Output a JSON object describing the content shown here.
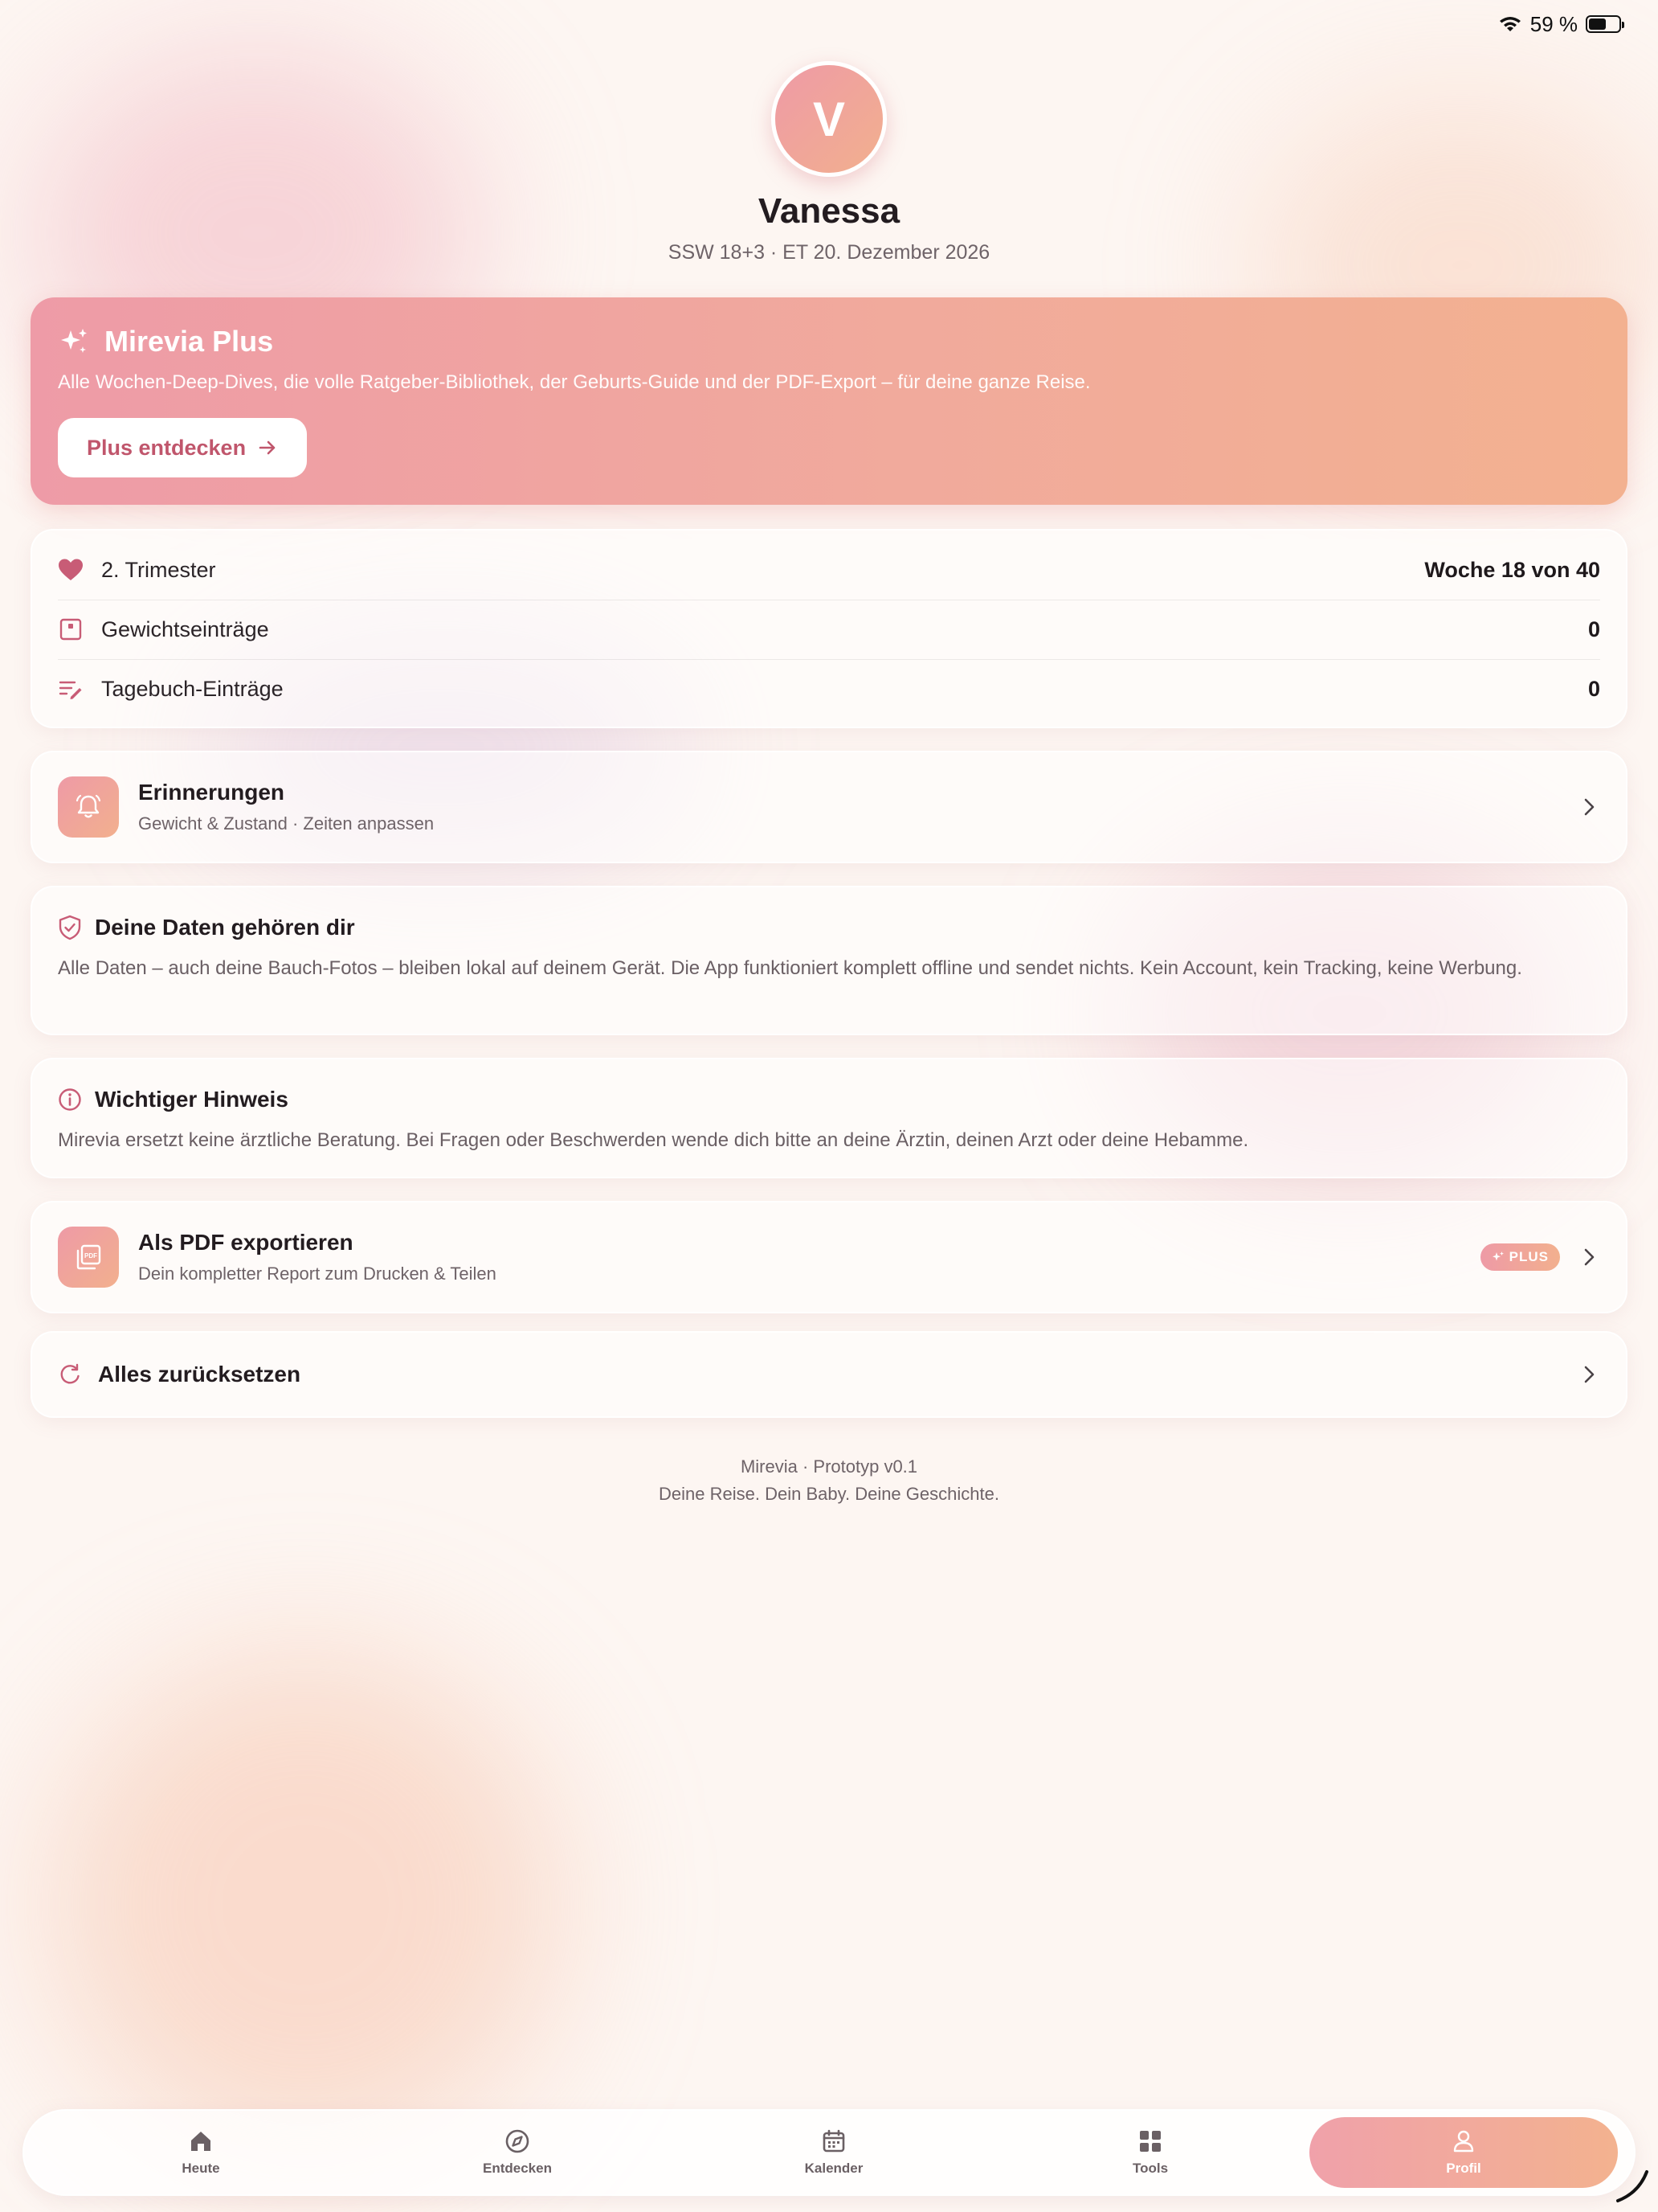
{
  "status": {
    "battery": "59 %"
  },
  "profile": {
    "initial": "V",
    "name": "Vanessa",
    "subtitle": "SSW 18+3 · ET 20. Dezember 2026"
  },
  "plus": {
    "title": "Mirevia Plus",
    "description": "Alle Wochen-Deep-Dives, die volle Ratgeber-Bibliothek, der Geburts-Guide und der PDF-Export – für deine ganze Reise.",
    "button_label": "Plus entdecken"
  },
  "stats": [
    {
      "icon": "heart-icon",
      "label": "2. Trimester",
      "value": "Woche 18 von 40"
    },
    {
      "icon": "scale-icon",
      "label": "Gewichtseinträge",
      "value": "0"
    },
    {
      "icon": "notes-edit-icon",
      "label": "Tagebuch-Einträge",
      "value": "0"
    }
  ],
  "reminders": {
    "title": "Erinnerungen",
    "subtitle": "Gewicht & Zustand · Zeiten anpassen"
  },
  "privacy": {
    "title": "Deine Daten gehören dir",
    "body": "Alle Daten – auch deine Bauch-Fotos – bleiben lokal auf deinem Gerät. Die App funktioniert komplett offline und sendet nichts. Kein Account, kein Tracking, keine Werbung."
  },
  "notice": {
    "title": "Wichtiger Hinweis",
    "body": "Mirevia ersetzt keine ärztliche Beratung. Bei Fragen oder Beschwerden wende dich bitte an deine Ärztin, deinen Arzt oder deine Hebamme."
  },
  "pdf_export": {
    "title": "Als PDF exportieren",
    "subtitle": "Dein kompletter Report zum Drucken & Teilen",
    "badge": "PLUS"
  },
  "reset": {
    "label": "Alles zurücksetzen"
  },
  "footer": {
    "line1": "Mirevia · Prototyp v0.1",
    "line2": "Deine Reise. Dein Baby. Deine Geschichte."
  },
  "tabs": [
    {
      "label": "Heute",
      "icon": "home-icon",
      "active": false
    },
    {
      "label": "Entdecken",
      "icon": "compass-icon",
      "active": false
    },
    {
      "label": "Kalender",
      "icon": "calendar-icon",
      "active": false
    },
    {
      "label": "Tools",
      "icon": "grid-icon",
      "active": false
    },
    {
      "label": "Profil",
      "icon": "user-icon",
      "active": true
    }
  ],
  "colors": {
    "accent": "#ee9aa6",
    "accent_end": "#f3b190",
    "accent_dark": "#c0566c",
    "background": "#fdf6f2"
  }
}
